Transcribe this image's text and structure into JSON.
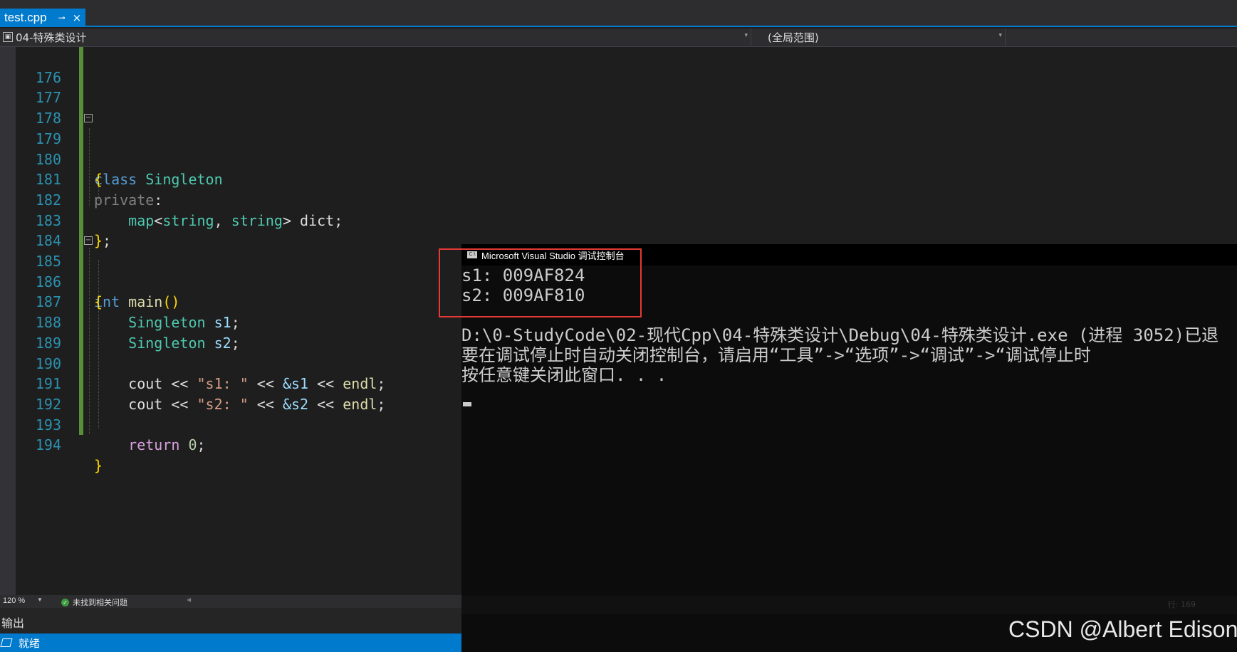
{
  "tab": {
    "filename": "test.cpp",
    "pin": "⊸",
    "close": "×"
  },
  "navbar": {
    "project": "04-特殊类设计",
    "scope": "(全局范围)"
  },
  "editor": {
    "zoom": "120 %",
    "issues": "未找到相关问题",
    "lines": [
      176,
      177,
      178,
      179,
      180,
      181,
      182,
      183,
      184,
      185,
      186,
      187,
      188,
      189,
      190,
      191,
      192,
      193,
      194
    ],
    "tokens": {
      "class_kw": "class",
      "class_name": "Singleton",
      "open_brace": "{",
      "private_kw": "private",
      "colon": ":",
      "map": "map",
      "lt": "<",
      "string": "string",
      "comma": ", ",
      "gt": ">",
      "dict": " dict;",
      "close_brace": "}",
      "semi": ";",
      "int_kw": "int",
      "main": "main",
      "parens": "()",
      "var_s1": "s1",
      "var_s2": "s2",
      "cout": "cout",
      "shl": " << ",
      "str_s1": "\"s1: \"",
      "str_s2": "\"s2: \"",
      "addr_s1": "&s1",
      "addr_s2": "&s2",
      "endl": "endl",
      "return_kw": "return",
      "zero": "0"
    }
  },
  "output": {
    "title": "输出"
  },
  "statusbar": {
    "text": "就绪"
  },
  "console": {
    "title": "Microsoft Visual Studio 调试控制台",
    "line1": "s1: 009AF824",
    "line2": "s2: 009AF810",
    "line3": "D:\\0-StudyCode\\02-现代Cpp\\04-特殊类设计\\Debug\\04-特殊类设计.exe (进程 3052)已退",
    "line4": "要在调试停止时自动关闭控制台，请启用“工具”->“选项”->“调试”->“调试停止时",
    "line5": "按任意键关闭此窗口. . .",
    "status_right": "行: 169"
  },
  "watermark": "CSDN @Albert Edison",
  "colors": {
    "accent": "#007acc",
    "highlight_box": "#e53935",
    "change_bar": "#578f37"
  }
}
